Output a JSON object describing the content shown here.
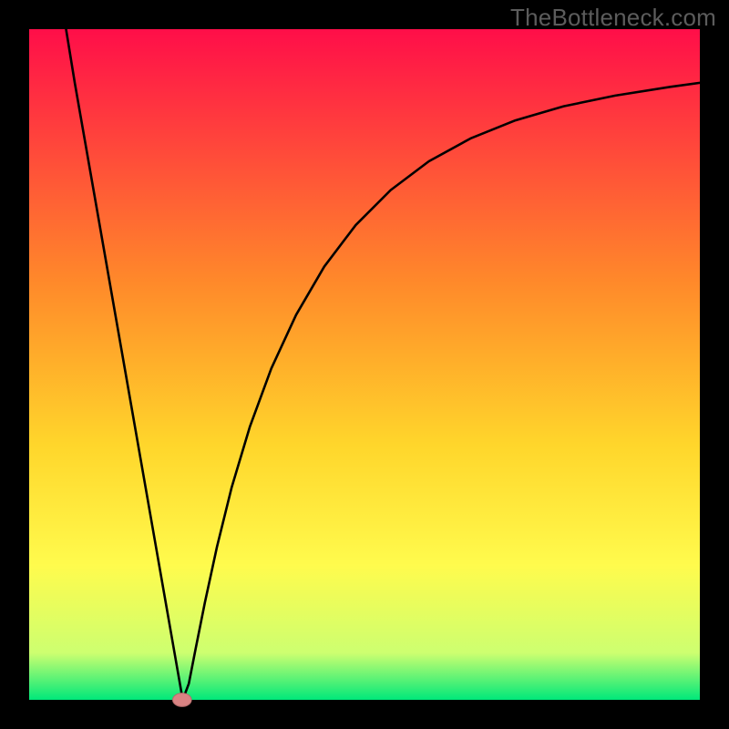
{
  "watermark": "TheBottleneck.com",
  "colors": {
    "frame": "#000000",
    "grad_top": "#ff0e49",
    "grad_mid1": "#ff8a2a",
    "grad_mid2": "#ffd62b",
    "grad_mid3": "#fffb4d",
    "grad_mid4": "#cdff70",
    "grad_bot": "#00e87a",
    "curve": "#000000",
    "marker_fill": "#d98383",
    "marker_stroke": "#b46b6b"
  },
  "chart_data": {
    "type": "line",
    "title": "",
    "xlabel": "",
    "ylabel": "",
    "xlim": [
      0,
      100
    ],
    "ylim": [
      0,
      100
    ],
    "curve_points": [
      {
        "x": 5.5,
        "y": 100
      },
      {
        "x": 6.8,
        "y": 92
      },
      {
        "x": 8.2,
        "y": 84
      },
      {
        "x": 9.6,
        "y": 76
      },
      {
        "x": 11.0,
        "y": 68
      },
      {
        "x": 12.4,
        "y": 60
      },
      {
        "x": 13.8,
        "y": 52
      },
      {
        "x": 15.2,
        "y": 44
      },
      {
        "x": 16.6,
        "y": 36
      },
      {
        "x": 18.0,
        "y": 28
      },
      {
        "x": 19.4,
        "y": 20
      },
      {
        "x": 20.8,
        "y": 12
      },
      {
        "x": 22.2,
        "y": 4
      },
      {
        "x": 22.9,
        "y": 0
      },
      {
        "x": 23.8,
        "y": 2.4
      },
      {
        "x": 24.8,
        "y": 7.5
      },
      {
        "x": 26.2,
        "y": 14.5
      },
      {
        "x": 28.0,
        "y": 22.8
      },
      {
        "x": 30.2,
        "y": 31.7
      },
      {
        "x": 32.9,
        "y": 40.7
      },
      {
        "x": 36.1,
        "y": 49.4
      },
      {
        "x": 39.8,
        "y": 57.4
      },
      {
        "x": 44.0,
        "y": 64.6
      },
      {
        "x": 48.7,
        "y": 70.8
      },
      {
        "x": 53.9,
        "y": 76.0
      },
      {
        "x": 59.6,
        "y": 80.3
      },
      {
        "x": 65.8,
        "y": 83.7
      },
      {
        "x": 72.5,
        "y": 86.4
      },
      {
        "x": 79.7,
        "y": 88.5
      },
      {
        "x": 87.4,
        "y": 90.1
      },
      {
        "x": 95.6,
        "y": 91.4
      },
      {
        "x": 100,
        "y": 92.0
      }
    ],
    "marker": {
      "x": 22.8,
      "y": 0,
      "rx": 1.4,
      "ry": 1.0
    }
  }
}
